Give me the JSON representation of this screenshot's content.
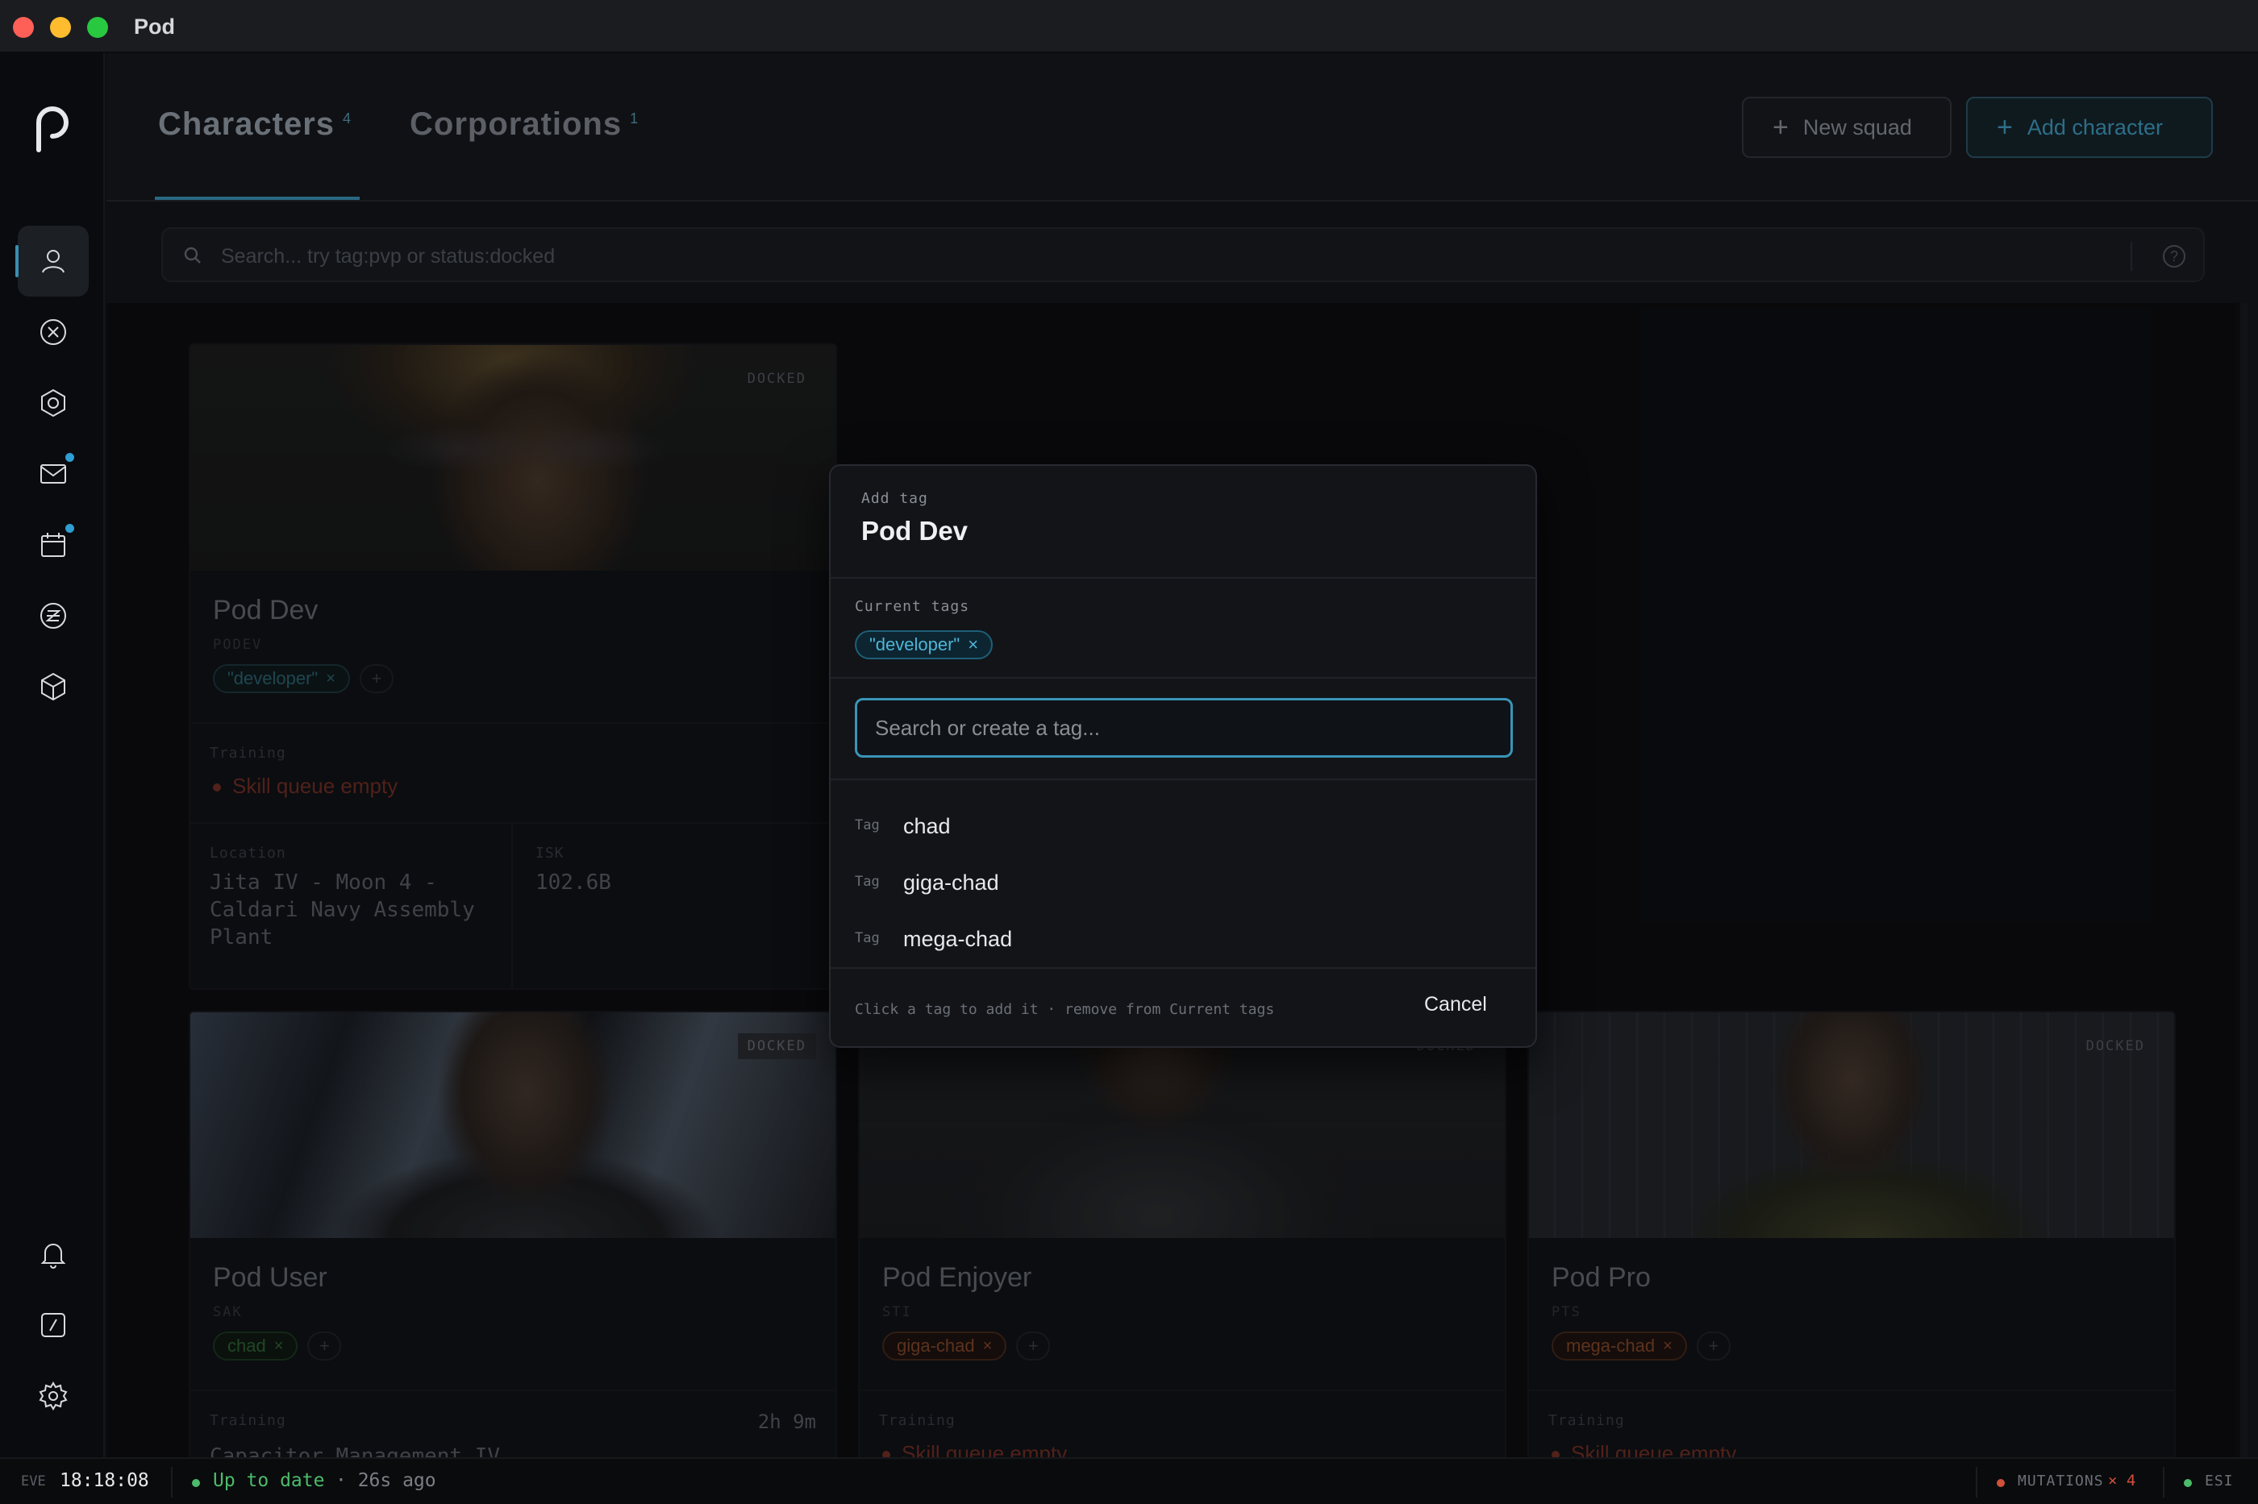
{
  "window": {
    "title": "Pod"
  },
  "header": {
    "tabs": [
      {
        "label": "Characters",
        "count": "4"
      },
      {
        "label": "Corporations",
        "count": "1"
      }
    ],
    "new_squad_label": "New squad",
    "add_character_label": "Add character"
  },
  "search": {
    "placeholder": "Search... try tag:pvp or status:docked"
  },
  "sidebar": {
    "items": [
      {
        "icon": "user-icon"
      },
      {
        "icon": "circle-x-icon"
      },
      {
        "icon": "hexagon-icon"
      },
      {
        "icon": "mail-icon"
      },
      {
        "icon": "calendar-icon"
      },
      {
        "icon": "z-circle-icon"
      },
      {
        "icon": "cube-icon"
      },
      {
        "icon": "bell-icon"
      },
      {
        "icon": "gauge-icon"
      },
      {
        "icon": "gear-icon"
      }
    ]
  },
  "cards": [
    {
      "name": "Pod Dev",
      "ticker": "PODEV",
      "status": "DOCKED",
      "tag": "\"developer\"",
      "training_label": "Training",
      "training": "Skill queue empty",
      "location_label": "Location",
      "location": "Jita IV - Moon 4 - Caldari Navy Assembly Plant",
      "isk_label": "ISK",
      "isk": "102.6B"
    },
    {
      "name": "Pod User",
      "ticker": "SAK",
      "status": "DOCKED",
      "tag": "chad",
      "training_label": "Training",
      "training": "Capacitor Management IV",
      "training_time": "2h 9m"
    },
    {
      "name": "Pod Enjoyer",
      "ticker": "STI",
      "status": "DOCKED",
      "tag": "giga-chad",
      "training_label": "Training",
      "training": "Skill queue empty"
    },
    {
      "name": "Pod Pro",
      "ticker": "PTS",
      "status": "DOCKED",
      "tag": "mega-chad",
      "training_label": "Training",
      "training": "Skill queue empty"
    }
  ],
  "modal": {
    "subtitle": "Add tag",
    "title": "Pod Dev",
    "current_tags_label": "Current tags",
    "current_tags": [
      "\"developer\""
    ],
    "input_placeholder": "Search or create a tag...",
    "options": [
      {
        "kind": "Tag",
        "name": "chad"
      },
      {
        "kind": "Tag",
        "name": "giga-chad"
      },
      {
        "kind": "Tag",
        "name": "mega-chad"
      }
    ],
    "hint": "Click a tag to add it · remove from Current tags",
    "cancel_label": "Cancel"
  },
  "statusbar": {
    "eve_label": "EVE",
    "clock": "18:18:08",
    "sync_status": "Up to date",
    "sync_ago": "· 26s ago",
    "mutations_label": "MUTATIONS",
    "mutations_count": "× 4",
    "esi_label": "ESI"
  },
  "colors": {
    "accent": "#3a94b8",
    "success": "#4cbb6a",
    "error": "#d0503a"
  }
}
